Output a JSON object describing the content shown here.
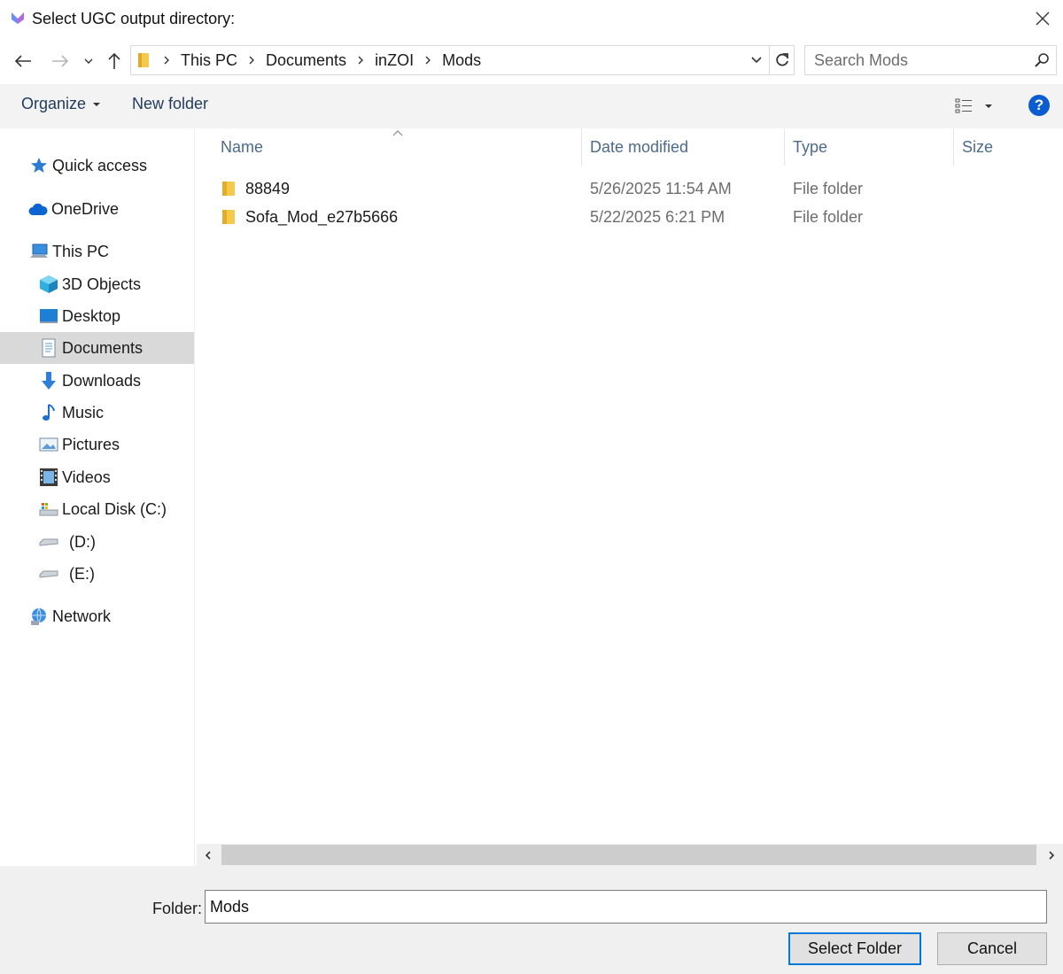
{
  "window": {
    "title": "Select UGC output directory:"
  },
  "address": {
    "crumbs": [
      "This PC",
      "Documents",
      "inZOI",
      "Mods"
    ]
  },
  "search": {
    "placeholder": "Search Mods"
  },
  "toolbar": {
    "organize_label": "Organize",
    "new_folder_label": "New folder",
    "help_label": "?"
  },
  "nav": {
    "quick_access": "Quick access",
    "onedrive": "OneDrive",
    "this_pc": "This PC",
    "objects3d": "3D Objects",
    "desktop": "Desktop",
    "documents": "Documents",
    "downloads": "Downloads",
    "music": "Music",
    "pictures": "Pictures",
    "videos": "Videos",
    "local_disk": "Local Disk (C:)",
    "drive_d": "(D:)",
    "drive_e": "(E:)",
    "network": "Network",
    "selected": "documents"
  },
  "columns": {
    "name": "Name",
    "date": "Date modified",
    "type": "Type",
    "size": "Size"
  },
  "files": [
    {
      "name": "88849",
      "date": "5/26/2025 11:54 AM",
      "type": "File folder",
      "size": ""
    },
    {
      "name": "Sofa_Mod_e27b5666",
      "date": "5/22/2025 6:21 PM",
      "type": "File folder",
      "size": ""
    }
  ],
  "footer": {
    "folder_label": "Folder:",
    "folder_value": "Mods",
    "select_label": "Select Folder",
    "cancel_label": "Cancel"
  },
  "colors": {
    "accent": "#0078d7",
    "help": "#0b5cd1",
    "folder": "#f5c94c",
    "selected_nav": "#d9d9d9"
  }
}
